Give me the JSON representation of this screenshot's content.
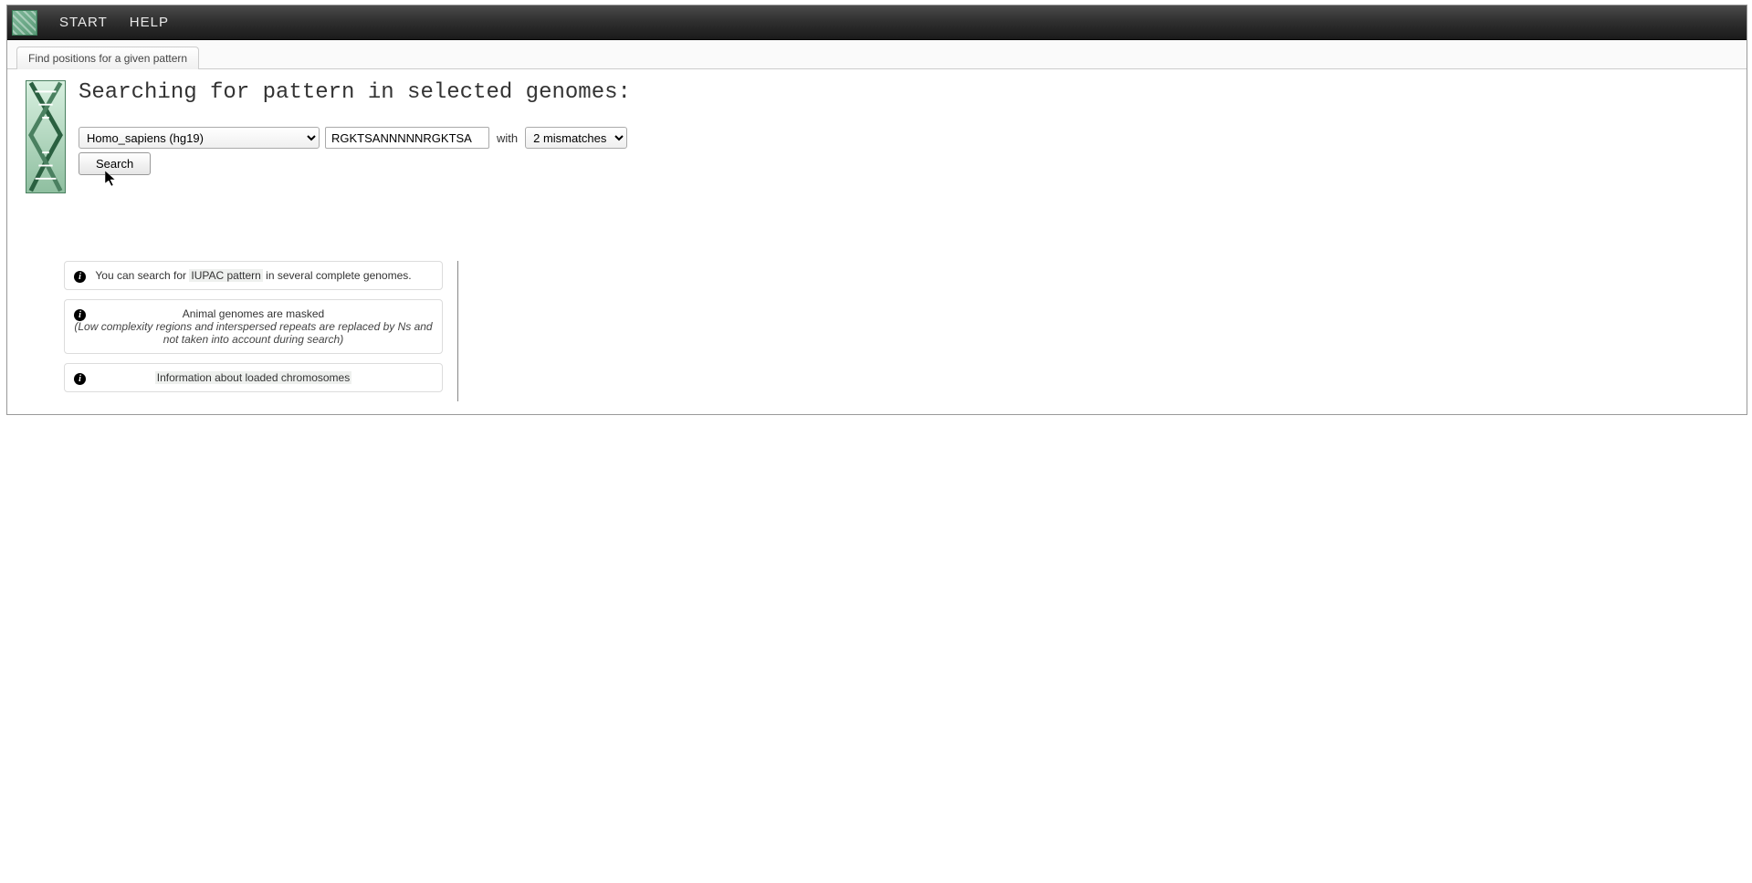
{
  "menubar": {
    "start": "START",
    "help": "HELP"
  },
  "tab": {
    "label": "Find positions for a given pattern"
  },
  "page": {
    "title": "Searching for pattern in selected genomes:"
  },
  "form": {
    "genome_selected": "Homo_sapiens (hg19)",
    "pattern_value": "RGKTSANNNNNRGKTSA",
    "with_label": "with",
    "mismatch_selected": "2 mismatches",
    "search_label": "Search"
  },
  "info": {
    "box1_pre": "You can search for ",
    "box1_link": "IUPAC pattern",
    "box1_post": " in several complete genomes.",
    "box2_line1": "Animal genomes are masked",
    "box2_line2": "(Low complexity regions and interspersed repeats are replaced by Ns and not taken into account during search)",
    "box3_link": "Information about loaded chromosomes"
  }
}
